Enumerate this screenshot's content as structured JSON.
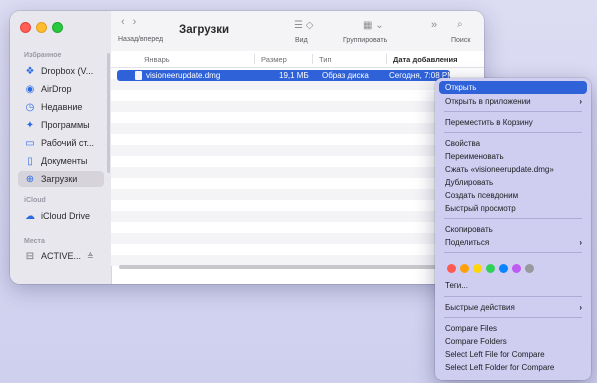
{
  "window": {
    "title": "Загрузки",
    "nav_label": "Назад/вперед",
    "view_label": "Вид",
    "group_label": "Группировать",
    "search_label": "Поиск"
  },
  "sidebar": {
    "favorites_header": "Избранное",
    "favorites": [
      {
        "label": "Dropbox (V...",
        "icon": "dropbox-icon"
      },
      {
        "label": "AirDrop",
        "icon": "airdrop-icon"
      },
      {
        "label": "Недавние",
        "icon": "clock-icon"
      },
      {
        "label": "Программы",
        "icon": "apps-icon"
      },
      {
        "label": "Рабочий ст...",
        "icon": "desktop-icon"
      },
      {
        "label": "Документы",
        "icon": "document-icon"
      },
      {
        "label": "Загрузки",
        "icon": "download-icon"
      }
    ],
    "icloud_header": "iCloud",
    "icloud_items": [
      {
        "label": "iCloud Drive",
        "icon": "cloud-icon"
      }
    ],
    "locations_header": "Места",
    "locations": [
      {
        "label": "ACTIVE...",
        "icon": "disk-icon",
        "eject": "≜"
      }
    ]
  },
  "columns": {
    "name": "Январь",
    "size": "Размер",
    "kind": "Тип",
    "date": "Дата добавления"
  },
  "file": {
    "name": "visioneerupdate.dmg",
    "size": "19,1 МБ",
    "kind": "Образ диска",
    "date": "Сегодня, 7:08 PM"
  },
  "context_menu": {
    "open": "Открыть",
    "open_with": "Открыть в приложении",
    "trash": "Переместить в Корзину",
    "info": "Свойства",
    "rename": "Переименовать",
    "compress": "Сжать «visioneerupdate.dmg»",
    "duplicate": "Дублировать",
    "alias": "Создать псевдоним",
    "quicklook": "Быстрый просмотр",
    "copy": "Скопировать",
    "share": "Поделиться",
    "tag_colors": [
      "#ff5a52",
      "#ff9f0a",
      "#ffd60a",
      "#30d158",
      "#0a84ff",
      "#bf5af2",
      "#98989d"
    ],
    "tags": "Теги...",
    "quick_actions": "Быстрые действия",
    "compare_files": "Compare Files",
    "compare_folders": "Compare Folders",
    "select_left_file": "Select Left File for Compare",
    "select_left_folder": "Select Left Folder for Compare"
  }
}
